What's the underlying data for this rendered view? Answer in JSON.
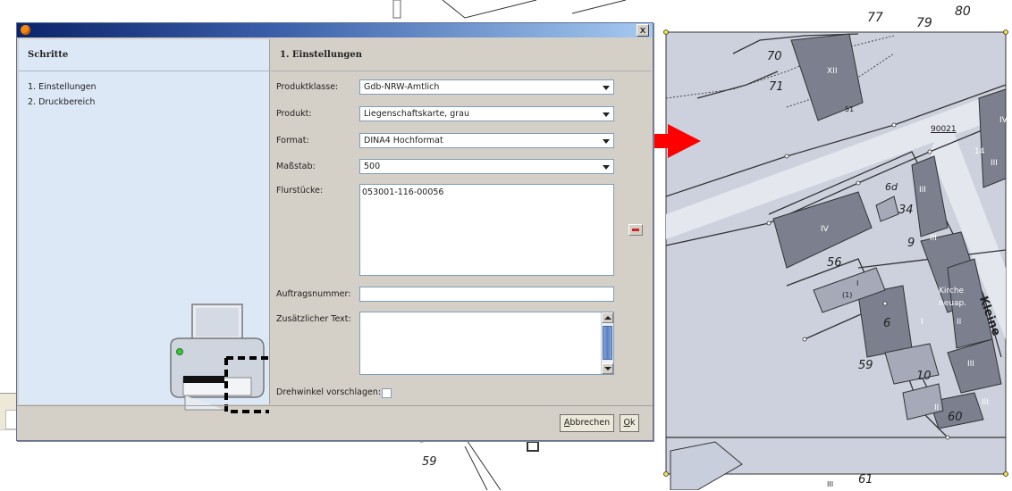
{
  "dialog": {
    "steps_title": "Schritte",
    "steps": [
      "1. Einstellungen",
      "2. Druckbereich"
    ],
    "content_title": "1. Einstellungen",
    "close_label": "x",
    "fields": {
      "produktklasse_label": "Produktklasse:",
      "produktklasse_value": "Gdb-NRW-Amtlich",
      "produkt_label": "Produkt:",
      "produkt_value": "Liegenschaftskarte, grau",
      "format_label": "Format:",
      "format_value": "DINA4 Hochformat",
      "massstab_label": "Maßstab:",
      "massstab_value": "500",
      "flurstuecke_label": "Flurstücke:",
      "flurstuecke_items": [
        "053001-116-00056"
      ],
      "auftrag_label": "Auftragsnummer:",
      "auftrag_value": "",
      "text_label": "Zusätzlicher Text:",
      "text_value": "",
      "drehwinkel_label": "Drehwinkel vorschlagen:",
      "drehwinkel_checked": false
    },
    "buttons": {
      "cancel": "Abbrechen",
      "ok": "Ok"
    }
  },
  "map": {
    "labels": [
      "77",
      "79",
      "80",
      "70",
      "71",
      "XII",
      "51",
      "90021",
      "14",
      "III",
      "IV",
      "X",
      "III",
      "6d",
      "III",
      "34",
      "IV",
      "9",
      "III",
      "56",
      "III",
      "I",
      "(1)",
      "Kirche",
      "neuap.",
      "6",
      "I",
      "II",
      "Kleine",
      "59",
      "10",
      "III",
      "III",
      "II",
      "60",
      "III",
      "59",
      "61",
      "III"
    ]
  },
  "colors": {
    "dialog_bg": "#d4d0c8",
    "steps_bg": "#dde8f7",
    "map_parcel": "#c9cedd",
    "map_building": "#7b7f8e",
    "arrow": "#ff0000"
  }
}
